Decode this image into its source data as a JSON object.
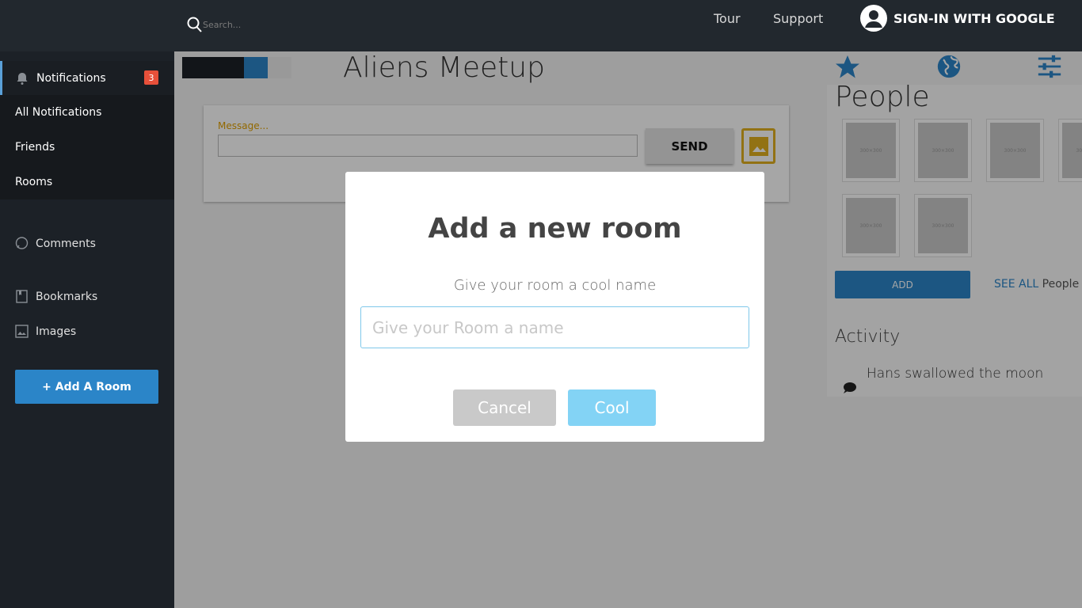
{
  "topbar": {
    "search_placeholder": "Search...",
    "nav": [
      "Tour",
      "Support"
    ],
    "signin_label": "SIGN-IN WITH GOOGLE"
  },
  "sidebar": {
    "notifications_label": "Notifications",
    "notifications_count": "3",
    "sub_items": [
      "All Notifications",
      "Friends",
      "Rooms"
    ],
    "comments_label": "Comments",
    "bookmarks_label": "Bookmarks",
    "images_label": "Images",
    "add_room_label": "+ Add A Room"
  },
  "main": {
    "title": "Aliens Meetup",
    "message_label": "Message...",
    "send_label": "SEND"
  },
  "right": {
    "people_title": "People",
    "thumb_label": "300×300",
    "add_label": "ADD",
    "see_all_link": "SEE ALL",
    "see_all_suffix": "People",
    "activity_title": "Activity",
    "activity_item": "Hans swallowed the moon"
  },
  "modal": {
    "title": "Add a new room",
    "subtitle": "Give your room a cool name",
    "input_placeholder": "Give your Room a name",
    "cancel_label": "Cancel",
    "cool_label": "Cool"
  },
  "colors": {
    "accent": "#2b85c8",
    "sidebar_bg": "#1c2127",
    "badge": "#e7503a",
    "cool_button": "#83d3f5"
  }
}
